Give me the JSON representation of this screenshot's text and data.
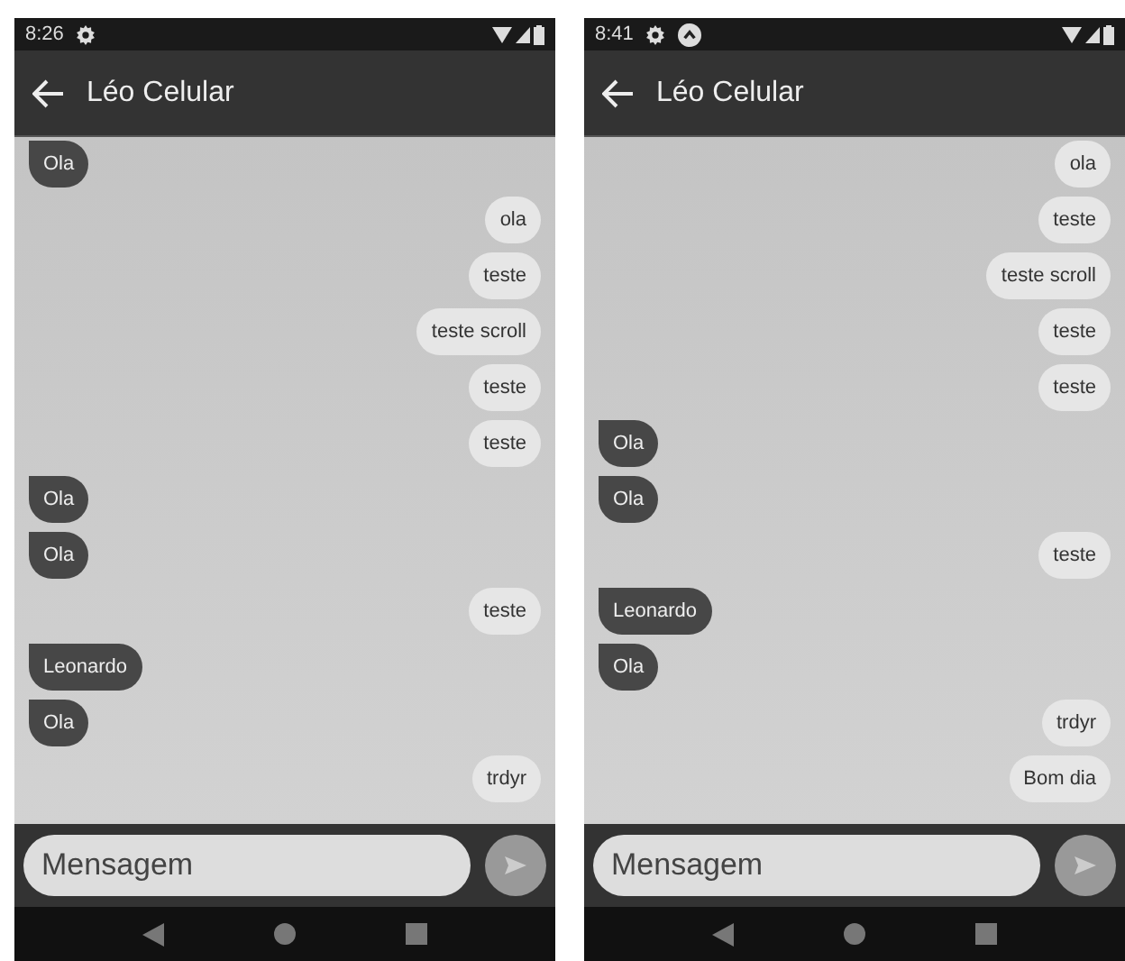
{
  "phones": [
    {
      "status_time": "8:26",
      "status_icons": [
        {
          "kind": "gear"
        }
      ],
      "title": "Léo Celular",
      "messages": [
        {
          "kind": "incoming",
          "text": "Ola"
        },
        {
          "kind": "outgoing",
          "text": "ola"
        },
        {
          "kind": "outgoing",
          "text": "teste"
        },
        {
          "kind": "outgoing",
          "text": "teste scroll"
        },
        {
          "kind": "outgoing",
          "text": "teste"
        },
        {
          "kind": "outgoing",
          "text": "teste"
        },
        {
          "kind": "incoming",
          "text": "Ola"
        },
        {
          "kind": "incoming",
          "text": "Ola"
        },
        {
          "kind": "outgoing",
          "text": "teste"
        },
        {
          "kind": "incoming",
          "text": "Leonardo"
        },
        {
          "kind": "incoming",
          "text": "Ola"
        },
        {
          "kind": "outgoing",
          "text": "trdyr"
        }
      ],
      "input": {
        "placeholder": "Mensagem"
      }
    },
    {
      "status_time": "8:41",
      "status_icons": [
        {
          "kind": "gear"
        },
        {
          "kind": "notification"
        }
      ],
      "title": "Léo Celular",
      "messages": [
        {
          "kind": "outgoing",
          "text": "ola"
        },
        {
          "kind": "outgoing",
          "text": "teste"
        },
        {
          "kind": "outgoing",
          "text": "teste scroll"
        },
        {
          "kind": "outgoing",
          "text": "teste"
        },
        {
          "kind": "outgoing",
          "text": "teste"
        },
        {
          "kind": "incoming",
          "text": "Ola"
        },
        {
          "kind": "incoming",
          "text": "Ola"
        },
        {
          "kind": "outgoing",
          "text": "teste"
        },
        {
          "kind": "incoming",
          "text": "Leonardo"
        },
        {
          "kind": "incoming",
          "text": "Ola"
        },
        {
          "kind": "outgoing",
          "text": "trdyr"
        },
        {
          "kind": "outgoing",
          "text": "Bom dia"
        }
      ],
      "input": {
        "placeholder": "Mensagem"
      }
    }
  ]
}
